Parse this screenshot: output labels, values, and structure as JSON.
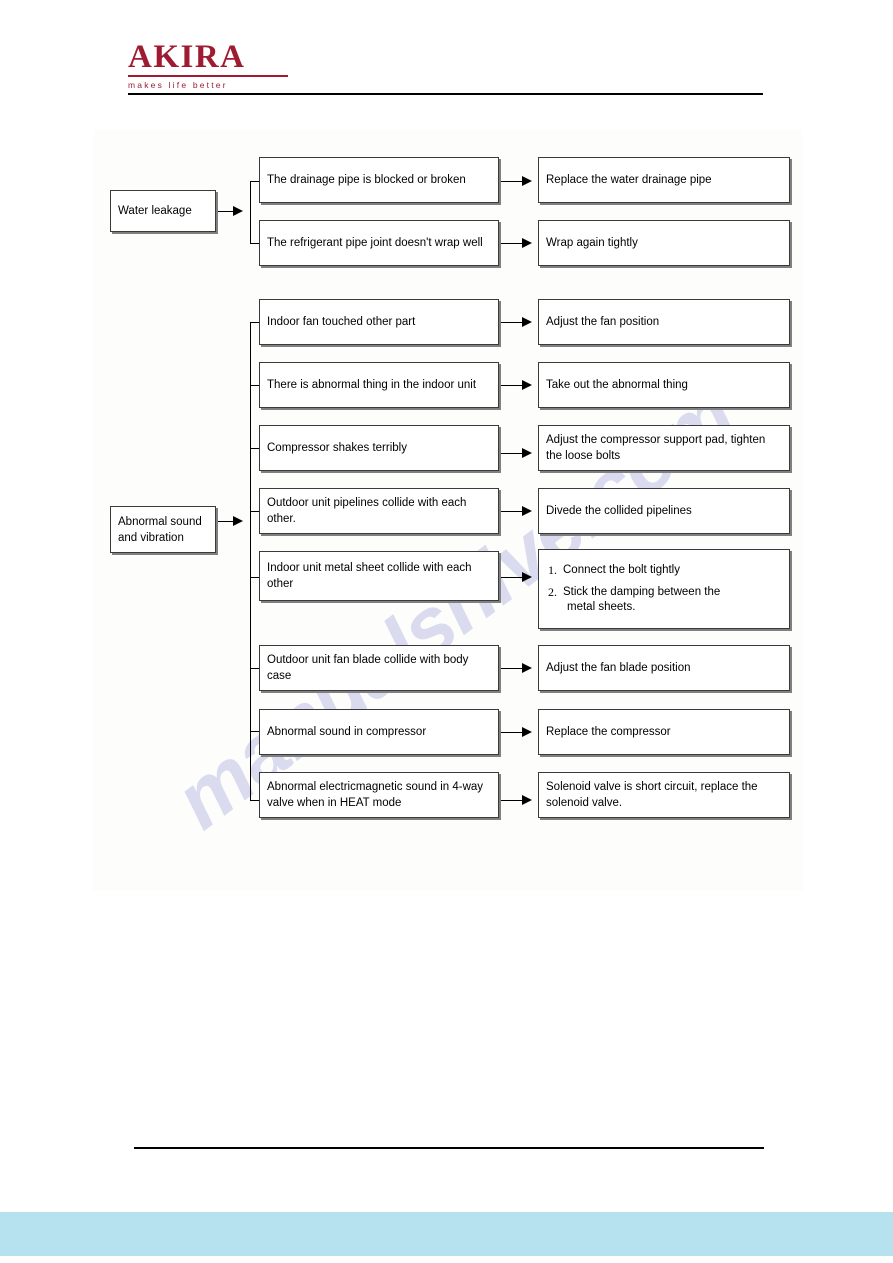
{
  "header": {
    "logo_word": "AKIRA",
    "logo_tagline": "makes life better"
  },
  "watermark": {
    "text": "manualshive.com"
  },
  "diagram": {
    "sections": [
      {
        "id": "water-leakage",
        "cause_label": "Water leakage",
        "rows": [
          {
            "problem": "The drainage pipe is blocked or broken",
            "solution": "Replace the water drainage pipe"
          },
          {
            "problem": "The refrigerant pipe joint doesn't wrap well",
            "solution": "Wrap again tightly"
          }
        ]
      },
      {
        "id": "abnormal-sound-and-vibration",
        "cause_label_line1": "Abnormal sound",
        "cause_label_line2": "and vibration",
        "rows": [
          {
            "problem": "Indoor fan touched other part",
            "solution": "Adjust the fan position"
          },
          {
            "problem": "There is abnormal thing in the indoor unit",
            "solution": "Take out the abnormal thing"
          },
          {
            "problem": "Compressor shakes terribly",
            "solution": "Adjust the compressor support pad, tighten the loose bolts"
          },
          {
            "problem": "Outdoor unit pipelines collide with each other.",
            "solution": "Divede the collided pipelines"
          },
          {
            "problem": "Indoor unit metal sheet collide with each other",
            "solution_list": [
              {
                "num": "1.",
                "text": "Connect the bolt tightly"
              },
              {
                "num": "2.",
                "text": "Stick the damping between the",
                "cont": "metal sheets."
              }
            ]
          },
          {
            "problem": "Outdoor unit fan blade collide with body case",
            "solution": "Adjust the fan blade position"
          },
          {
            "problem": "Abnormal sound in compressor",
            "solution": "Replace the compressor"
          },
          {
            "problem": "Abnormal electricmagnetic sound in 4-way valve when in HEAT mode",
            "solution": "Solenoid valve is short circuit, replace the solenoid valve."
          }
        ]
      }
    ]
  }
}
